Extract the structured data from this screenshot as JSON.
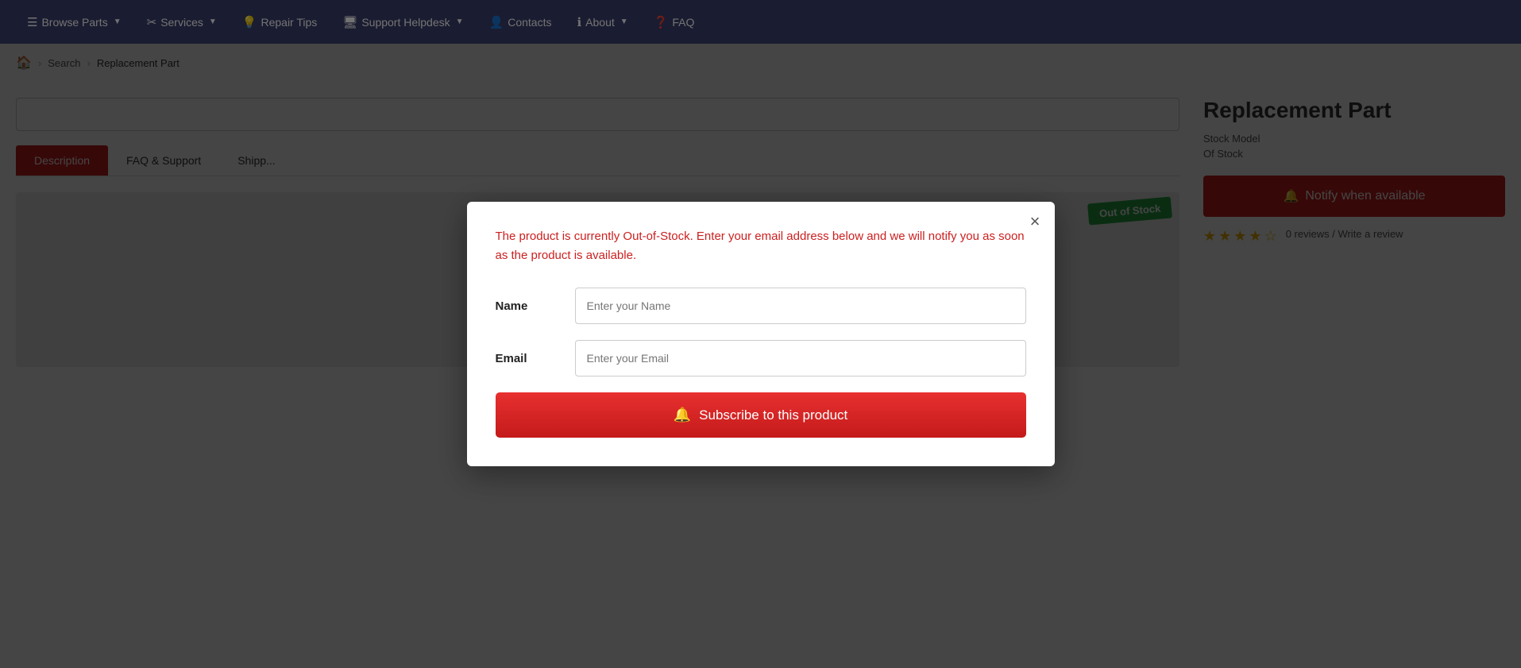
{
  "navbar": {
    "items": [
      {
        "label": "Browse Parts",
        "icon": "☰",
        "hasArrow": true,
        "name": "browse-parts"
      },
      {
        "label": "Services",
        "icon": "✂",
        "hasArrow": true,
        "name": "services"
      },
      {
        "label": "Repair Tips",
        "icon": "💡",
        "hasArrow": false,
        "name": "repair-tips"
      },
      {
        "label": "Support Helpdesk",
        "icon": "🖥",
        "hasArrow": true,
        "name": "support-helpdesk"
      },
      {
        "label": "Contacts",
        "icon": "👤",
        "hasArrow": false,
        "name": "contacts"
      },
      {
        "label": "About",
        "icon": "ℹ",
        "hasArrow": true,
        "name": "about"
      },
      {
        "label": "FAQ",
        "icon": "❓",
        "hasArrow": false,
        "name": "faq"
      }
    ]
  },
  "breadcrumb": {
    "home": "🏠",
    "search": "Search",
    "current": "Replacement Part"
  },
  "tabs": [
    {
      "label": "Description",
      "active": true
    },
    {
      "label": "FAQ & Support",
      "active": false
    },
    {
      "label": "Shipp...",
      "active": false
    }
  ],
  "product": {
    "title": "Replacement Part",
    "badge": "Out of Stock",
    "meta1": "Stock Model",
    "meta2": "Of Stock",
    "notify_label": "Notify when available",
    "stars": [
      "★",
      "★",
      "★",
      "★",
      "☆"
    ],
    "review_text": "0 reviews / Write a review"
  },
  "modal": {
    "message": "The product is currently Out-of-Stock. Enter your email address below and we will notify you as soon as the product is available.",
    "name_label": "Name",
    "name_placeholder": "Enter your Name",
    "email_label": "Email",
    "email_placeholder": "Enter your Email",
    "subscribe_label": "Subscribe to this product",
    "bell_icon": "🔔",
    "close_label": "×"
  }
}
